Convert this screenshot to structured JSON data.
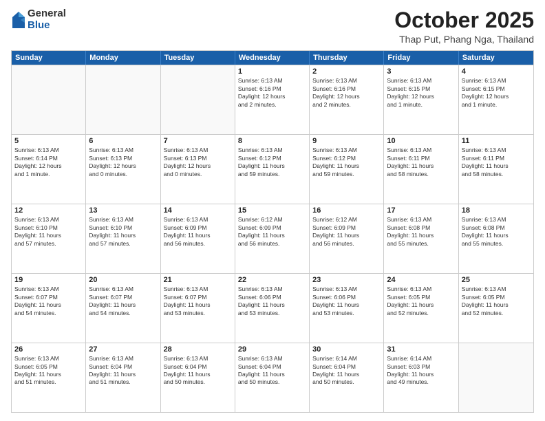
{
  "header": {
    "logo": {
      "general": "General",
      "blue": "Blue"
    },
    "title": "October 2025",
    "location": "Thap Put, Phang Nga, Thailand"
  },
  "days": [
    "Sunday",
    "Monday",
    "Tuesday",
    "Wednesday",
    "Thursday",
    "Friday",
    "Saturday"
  ],
  "weeks": [
    [
      {
        "day": "",
        "info": ""
      },
      {
        "day": "",
        "info": ""
      },
      {
        "day": "",
        "info": ""
      },
      {
        "day": "1",
        "info": "Sunrise: 6:13 AM\nSunset: 6:16 PM\nDaylight: 12 hours\nand 2 minutes."
      },
      {
        "day": "2",
        "info": "Sunrise: 6:13 AM\nSunset: 6:16 PM\nDaylight: 12 hours\nand 2 minutes."
      },
      {
        "day": "3",
        "info": "Sunrise: 6:13 AM\nSunset: 6:15 PM\nDaylight: 12 hours\nand 1 minute."
      },
      {
        "day": "4",
        "info": "Sunrise: 6:13 AM\nSunset: 6:15 PM\nDaylight: 12 hours\nand 1 minute."
      }
    ],
    [
      {
        "day": "5",
        "info": "Sunrise: 6:13 AM\nSunset: 6:14 PM\nDaylight: 12 hours\nand 1 minute."
      },
      {
        "day": "6",
        "info": "Sunrise: 6:13 AM\nSunset: 6:13 PM\nDaylight: 12 hours\nand 0 minutes."
      },
      {
        "day": "7",
        "info": "Sunrise: 6:13 AM\nSunset: 6:13 PM\nDaylight: 12 hours\nand 0 minutes."
      },
      {
        "day": "8",
        "info": "Sunrise: 6:13 AM\nSunset: 6:12 PM\nDaylight: 11 hours\nand 59 minutes."
      },
      {
        "day": "9",
        "info": "Sunrise: 6:13 AM\nSunset: 6:12 PM\nDaylight: 11 hours\nand 59 minutes."
      },
      {
        "day": "10",
        "info": "Sunrise: 6:13 AM\nSunset: 6:11 PM\nDaylight: 11 hours\nand 58 minutes."
      },
      {
        "day": "11",
        "info": "Sunrise: 6:13 AM\nSunset: 6:11 PM\nDaylight: 11 hours\nand 58 minutes."
      }
    ],
    [
      {
        "day": "12",
        "info": "Sunrise: 6:13 AM\nSunset: 6:10 PM\nDaylight: 11 hours\nand 57 minutes."
      },
      {
        "day": "13",
        "info": "Sunrise: 6:13 AM\nSunset: 6:10 PM\nDaylight: 11 hours\nand 57 minutes."
      },
      {
        "day": "14",
        "info": "Sunrise: 6:13 AM\nSunset: 6:09 PM\nDaylight: 11 hours\nand 56 minutes."
      },
      {
        "day": "15",
        "info": "Sunrise: 6:12 AM\nSunset: 6:09 PM\nDaylight: 11 hours\nand 56 minutes."
      },
      {
        "day": "16",
        "info": "Sunrise: 6:12 AM\nSunset: 6:09 PM\nDaylight: 11 hours\nand 56 minutes."
      },
      {
        "day": "17",
        "info": "Sunrise: 6:13 AM\nSunset: 6:08 PM\nDaylight: 11 hours\nand 55 minutes."
      },
      {
        "day": "18",
        "info": "Sunrise: 6:13 AM\nSunset: 6:08 PM\nDaylight: 11 hours\nand 55 minutes."
      }
    ],
    [
      {
        "day": "19",
        "info": "Sunrise: 6:13 AM\nSunset: 6:07 PM\nDaylight: 11 hours\nand 54 minutes."
      },
      {
        "day": "20",
        "info": "Sunrise: 6:13 AM\nSunset: 6:07 PM\nDaylight: 11 hours\nand 54 minutes."
      },
      {
        "day": "21",
        "info": "Sunrise: 6:13 AM\nSunset: 6:07 PM\nDaylight: 11 hours\nand 53 minutes."
      },
      {
        "day": "22",
        "info": "Sunrise: 6:13 AM\nSunset: 6:06 PM\nDaylight: 11 hours\nand 53 minutes."
      },
      {
        "day": "23",
        "info": "Sunrise: 6:13 AM\nSunset: 6:06 PM\nDaylight: 11 hours\nand 53 minutes."
      },
      {
        "day": "24",
        "info": "Sunrise: 6:13 AM\nSunset: 6:05 PM\nDaylight: 11 hours\nand 52 minutes."
      },
      {
        "day": "25",
        "info": "Sunrise: 6:13 AM\nSunset: 6:05 PM\nDaylight: 11 hours\nand 52 minutes."
      }
    ],
    [
      {
        "day": "26",
        "info": "Sunrise: 6:13 AM\nSunset: 6:05 PM\nDaylight: 11 hours\nand 51 minutes."
      },
      {
        "day": "27",
        "info": "Sunrise: 6:13 AM\nSunset: 6:04 PM\nDaylight: 11 hours\nand 51 minutes."
      },
      {
        "day": "28",
        "info": "Sunrise: 6:13 AM\nSunset: 6:04 PM\nDaylight: 11 hours\nand 50 minutes."
      },
      {
        "day": "29",
        "info": "Sunrise: 6:13 AM\nSunset: 6:04 PM\nDaylight: 11 hours\nand 50 minutes."
      },
      {
        "day": "30",
        "info": "Sunrise: 6:14 AM\nSunset: 6:04 PM\nDaylight: 11 hours\nand 50 minutes."
      },
      {
        "day": "31",
        "info": "Sunrise: 6:14 AM\nSunset: 6:03 PM\nDaylight: 11 hours\nand 49 minutes."
      },
      {
        "day": "",
        "info": ""
      }
    ]
  ]
}
